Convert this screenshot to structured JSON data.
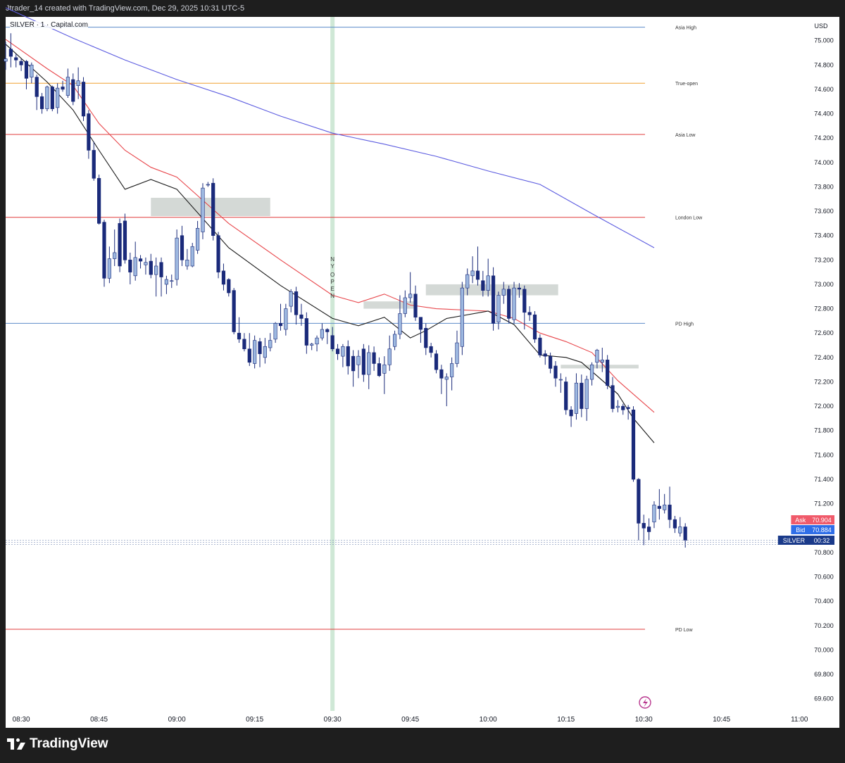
{
  "header": {
    "credit": "Jtrader_14 created with TradingView.com, Dec 29, 2025 10:31 UTC-5"
  },
  "symbol_label": "SILVER · 1 · Capital.com",
  "footer": {
    "brand": "TradingView"
  },
  "colors": {
    "bull": "#9db8e0",
    "bear": "#1a2a7a",
    "ema_fast": "#1b1b1b",
    "ema_mid": "#e8474c",
    "ema_slow": "#5c5ce0",
    "level_blue": "#5b8cc9",
    "level_red": "#e03d3d",
    "level_orange": "#f0a030",
    "zone": "#c5ccc8",
    "session": "#a8d5b4",
    "ask": "#f05a6a",
    "bid": "#2f6ee8",
    "symbol_tag": "#1a3a8a"
  },
  "chart_data": {
    "type": "candlestick",
    "title": "SILVER · 1 · Capital.com",
    "currency": "USD",
    "ylim": [
      69.5,
      75.2
    ],
    "y_ticks": [
      "75.000",
      "74.800",
      "74.600",
      "74.400",
      "74.200",
      "74.000",
      "73.800",
      "73.600",
      "73.400",
      "73.200",
      "73.000",
      "72.800",
      "72.600",
      "72.400",
      "72.200",
      "72.000",
      "71.800",
      "71.600",
      "71.400",
      "71.200",
      "71.000",
      "70.800",
      "70.600",
      "70.400",
      "70.200",
      "70.000",
      "69.800",
      "69.600"
    ],
    "x_ticks": [
      {
        "label": "08:30",
        "minute": 0
      },
      {
        "label": "08:45",
        "minute": 15
      },
      {
        "label": "09:00",
        "minute": 30
      },
      {
        "label": "09:15",
        "minute": 45
      },
      {
        "label": "09:30",
        "minute": 60
      },
      {
        "label": "09:45",
        "minute": 75
      },
      {
        "label": "10:00",
        "minute": 90
      },
      {
        "label": "10:15",
        "minute": 105
      },
      {
        "label": "10:30",
        "minute": 120
      },
      {
        "label": "10:45",
        "minute": 135
      },
      {
        "label": "11:00",
        "minute": 150
      }
    ],
    "xlim_minutes": [
      -3,
      152
    ],
    "levels": [
      {
        "label": "Asia High",
        "price": 75.11,
        "color": "#5b8cc9"
      },
      {
        "label": "True-open",
        "price": 74.65,
        "color": "#f0a030"
      },
      {
        "label": "Asia Low",
        "price": 74.23,
        "color": "#e03d3d"
      },
      {
        "label": "London Low",
        "price": 73.55,
        "color": "#e03d3d"
      },
      {
        "label": "PD High",
        "price": 72.68,
        "color": "#5b8cc9"
      },
      {
        "label": "PD Low",
        "price": 70.17,
        "color": "#e03d3d"
      }
    ],
    "session_marker": {
      "label": "NY OPEN",
      "minute": 60
    },
    "zones": [
      {
        "m0": 25,
        "m1": 48,
        "p0": 73.71,
        "p1": 73.56
      },
      {
        "m0": 66,
        "m1": 76,
        "p0": 72.86,
        "p1": 72.8
      },
      {
        "m0": 78,
        "m1": 103.5,
        "p0": 73.0,
        "p1": 72.91
      },
      {
        "m0": 104,
        "m1": 119,
        "p0": 72.34,
        "p1": 72.31
      }
    ],
    "ema_fast": [
      [
        -3,
        74.97
      ],
      [
        5,
        74.66
      ],
      [
        10,
        74.43
      ],
      [
        15,
        74.1
      ],
      [
        20,
        73.78
      ],
      [
        25,
        73.86
      ],
      [
        30,
        73.78
      ],
      [
        40,
        73.3
      ],
      [
        50,
        72.99
      ],
      [
        60,
        72.72
      ],
      [
        65,
        72.66
      ],
      [
        70,
        72.73
      ],
      [
        75,
        72.56
      ],
      [
        78,
        72.62
      ],
      [
        82,
        72.72
      ],
      [
        90,
        72.78
      ],
      [
        95,
        72.67
      ],
      [
        100,
        72.42
      ],
      [
        105,
        72.4
      ],
      [
        108,
        72.36
      ],
      [
        115,
        72.1
      ],
      [
        118,
        71.9
      ],
      [
        122,
        71.7
      ]
    ],
    "ema_mid": [
      [
        -3,
        75.01
      ],
      [
        5,
        74.77
      ],
      [
        10,
        74.63
      ],
      [
        15,
        74.32
      ],
      [
        20,
        74.1
      ],
      [
        25,
        73.96
      ],
      [
        30,
        73.88
      ],
      [
        40,
        73.5
      ],
      [
        50,
        73.2
      ],
      [
        60,
        72.91
      ],
      [
        65,
        72.85
      ],
      [
        70,
        72.92
      ],
      [
        75,
        72.83
      ],
      [
        80,
        72.8
      ],
      [
        90,
        72.78
      ],
      [
        95,
        72.72
      ],
      [
        100,
        72.6
      ],
      [
        105,
        72.53
      ],
      [
        110,
        72.44
      ],
      [
        115,
        72.21
      ],
      [
        122,
        71.95
      ]
    ],
    "ema_slow": [
      [
        -3,
        75.27
      ],
      [
        10,
        75.02
      ],
      [
        20,
        74.84
      ],
      [
        30,
        74.68
      ],
      [
        40,
        74.54
      ],
      [
        50,
        74.38
      ],
      [
        60,
        74.24
      ],
      [
        70,
        74.15
      ],
      [
        80,
        74.05
      ],
      [
        90,
        73.93
      ],
      [
        100,
        73.82
      ],
      [
        110,
        73.58
      ],
      [
        122,
        73.3
      ]
    ],
    "candles": [
      [
        -3,
        74.83,
        74.85,
        74.99,
        74.76
      ],
      [
        -2,
        74.93,
        74.87,
        75.06,
        74.78
      ],
      [
        -1,
        74.86,
        74.84,
        74.89,
        74.78
      ],
      [
        0,
        74.83,
        74.8,
        74.85,
        74.75
      ],
      [
        1,
        74.83,
        74.69,
        74.84,
        74.6
      ],
      [
        2,
        74.7,
        74.8,
        74.82,
        74.65
      ],
      [
        3,
        74.7,
        74.54,
        74.72,
        74.43
      ],
      [
        4,
        74.54,
        74.44,
        74.57,
        74.4
      ],
      [
        5,
        74.44,
        74.62,
        74.63,
        74.42
      ],
      [
        6,
        74.62,
        74.44,
        74.63,
        74.42
      ],
      [
        7,
        74.45,
        74.61,
        74.65,
        74.4
      ],
      [
        8,
        74.62,
        74.6,
        74.67,
        74.58
      ],
      [
        9,
        74.55,
        74.7,
        74.77,
        74.53
      ],
      [
        10,
        74.68,
        74.5,
        74.73,
        74.47
      ],
      [
        11,
        74.63,
        74.67,
        74.78,
        74.52
      ],
      [
        12,
        74.66,
        74.38,
        74.7,
        74.34
      ],
      [
        13,
        74.4,
        74.1,
        74.43,
        74.03
      ],
      [
        14,
        74.1,
        73.87,
        74.17,
        73.85
      ],
      [
        15,
        73.87,
        73.5,
        73.9,
        73.49
      ],
      [
        16,
        73.51,
        73.05,
        73.53,
        72.98
      ],
      [
        17,
        73.05,
        73.21,
        73.31,
        73.01
      ],
      [
        18,
        73.21,
        73.26,
        73.45,
        73.15
      ],
      [
        19,
        73.5,
        73.15,
        73.54,
        73.1
      ],
      [
        20,
        73.52,
        73.2,
        73.58,
        73.17
      ],
      [
        21,
        73.2,
        73.1,
        73.26,
        73.0
      ],
      [
        22,
        73.07,
        73.22,
        73.35,
        73.03
      ],
      [
        23,
        73.21,
        73.19,
        73.24,
        73.13
      ],
      [
        24,
        73.16,
        73.18,
        73.22,
        73.08
      ],
      [
        25,
        73.19,
        73.08,
        73.25,
        73.05
      ],
      [
        26,
        73.08,
        73.15,
        73.22,
        72.9
      ],
      [
        27,
        73.18,
        73.06,
        73.22,
        72.9
      ],
      [
        28,
        73.0,
        73.04,
        73.07,
        72.92
      ],
      [
        29,
        73.03,
        73.03,
        73.08,
        72.97
      ],
      [
        30,
        73.04,
        73.38,
        73.45,
        72.99
      ],
      [
        31,
        73.4,
        73.2,
        73.48,
        73.15
      ],
      [
        32,
        73.15,
        73.2,
        73.29,
        73.12
      ],
      [
        33,
        73.15,
        73.31,
        73.34,
        73.14
      ],
      [
        34,
        73.28,
        73.46,
        73.52,
        73.25
      ],
      [
        35,
        73.43,
        73.79,
        73.83,
        73.37
      ],
      [
        36,
        73.82,
        73.82,
        73.84,
        73.8
      ],
      [
        37,
        73.83,
        73.4,
        73.87,
        73.36
      ],
      [
        38,
        73.4,
        73.1,
        73.43,
        73.05
      ],
      [
        39,
        73.11,
        73.0,
        73.17,
        72.95
      ],
      [
        40,
        73.04,
        72.93,
        73.05,
        72.9
      ],
      [
        41,
        72.95,
        72.61,
        72.97,
        72.59
      ],
      [
        42,
        72.6,
        72.55,
        72.73,
        72.52
      ],
      [
        43,
        72.55,
        72.47,
        72.6,
        72.45
      ],
      [
        44,
        72.47,
        72.36,
        72.6,
        72.33
      ],
      [
        45,
        72.35,
        72.54,
        72.58,
        72.31
      ],
      [
        46,
        72.53,
        72.43,
        72.56,
        72.32
      ],
      [
        47,
        72.4,
        72.49,
        72.56,
        72.35
      ],
      [
        48,
        72.48,
        72.54,
        72.6,
        72.45
      ],
      [
        49,
        72.55,
        72.68,
        72.69,
        72.52
      ],
      [
        50,
        72.68,
        72.66,
        72.84,
        72.62
      ],
      [
        51,
        72.63,
        72.8,
        72.84,
        72.58
      ],
      [
        52,
        72.82,
        72.94,
        72.96,
        72.77
      ],
      [
        53,
        72.94,
        72.75,
        72.98,
        72.67
      ],
      [
        54,
        72.75,
        72.72,
        72.84,
        72.66
      ],
      [
        55,
        72.72,
        72.5,
        72.77,
        72.43
      ],
      [
        56,
        72.5,
        72.51,
        72.52,
        72.46
      ],
      [
        57,
        72.51,
        72.56,
        72.58,
        72.45
      ],
      [
        58,
        72.56,
        72.63,
        72.68,
        72.54
      ],
      [
        59,
        72.63,
        72.61,
        72.64,
        72.51
      ],
      [
        60,
        72.58,
        72.47,
        72.65,
        72.45
      ],
      [
        61,
        72.47,
        72.43,
        72.51,
        72.38
      ],
      [
        62,
        72.41,
        72.49,
        72.51,
        72.32
      ],
      [
        63,
        72.49,
        72.33,
        72.54,
        72.26
      ],
      [
        64,
        72.41,
        72.29,
        72.46,
        72.16
      ],
      [
        65,
        72.34,
        72.41,
        72.46,
        72.23
      ],
      [
        66,
        72.47,
        72.26,
        72.51,
        72.2
      ],
      [
        67,
        72.26,
        72.44,
        72.5,
        72.14
      ],
      [
        68,
        72.44,
        72.35,
        72.49,
        72.29
      ],
      [
        69,
        72.35,
        72.25,
        72.4,
        72.24
      ],
      [
        70,
        72.27,
        72.34,
        72.41,
        72.1
      ],
      [
        71,
        72.34,
        72.47,
        72.58,
        72.29
      ],
      [
        72,
        72.49,
        72.59,
        72.62,
        72.46
      ],
      [
        73,
        72.59,
        72.76,
        72.91,
        72.55
      ],
      [
        74,
        72.76,
        72.89,
        72.95,
        72.73
      ],
      [
        75,
        72.89,
        72.92,
        73.1,
        72.85
      ],
      [
        76,
        72.92,
        72.73,
        72.99,
        72.7
      ],
      [
        77,
        72.73,
        72.63,
        72.73,
        72.52
      ],
      [
        78,
        72.64,
        72.48,
        72.68,
        72.42
      ],
      [
        79,
        72.49,
        72.44,
        72.52,
        72.4
      ],
      [
        80,
        72.43,
        72.3,
        72.46,
        72.27
      ],
      [
        81,
        72.3,
        72.23,
        72.34,
        72.1
      ],
      [
        82,
        72.22,
        72.24,
        72.27,
        72.0
      ],
      [
        83,
        72.24,
        72.35,
        72.4,
        72.13
      ],
      [
        84,
        72.35,
        72.52,
        72.62,
        72.32
      ],
      [
        85,
        72.49,
        72.97,
        73.02,
        72.42
      ],
      [
        86,
        72.97,
        73.08,
        73.13,
        72.91
      ],
      [
        87,
        73.07,
        73.11,
        73.23,
        73.01
      ],
      [
        88,
        73.11,
        73.04,
        73.31,
        72.99
      ],
      [
        89,
        73.03,
        72.95,
        73.11,
        72.9
      ],
      [
        90,
        72.95,
        73.07,
        73.21,
        72.9
      ],
      [
        91,
        73.07,
        72.68,
        73.14,
        72.62
      ],
      [
        92,
        72.69,
        72.91,
        72.94,
        72.63
      ],
      [
        93,
        72.91,
        72.96,
        73.02,
        72.84
      ],
      [
        94,
        72.96,
        72.72,
        72.99,
        72.68
      ],
      [
        95,
        72.71,
        72.97,
        73.02,
        72.68
      ],
      [
        96,
        72.97,
        72.96,
        73.01,
        72.89
      ],
      [
        97,
        72.96,
        72.77,
        72.99,
        72.63
      ],
      [
        98,
        72.77,
        72.75,
        72.82,
        72.7
      ],
      [
        99,
        72.75,
        72.55,
        72.78,
        72.52
      ],
      [
        100,
        72.56,
        72.42,
        72.59,
        72.4
      ],
      [
        101,
        72.43,
        72.41,
        72.46,
        72.34
      ],
      [
        102,
        72.41,
        72.31,
        72.44,
        72.27
      ],
      [
        103,
        72.33,
        72.23,
        72.37,
        72.16
      ],
      [
        104,
        72.22,
        72.22,
        72.27,
        72.11
      ],
      [
        105,
        72.2,
        71.97,
        72.24,
        71.93
      ],
      [
        106,
        71.97,
        71.92,
        72.0,
        71.83
      ],
      [
        107,
        71.94,
        72.19,
        72.27,
        71.89
      ],
      [
        108,
        72.19,
        71.98,
        72.26,
        71.91
      ],
      [
        109,
        71.98,
        72.22,
        72.25,
        71.88
      ],
      [
        110,
        72.22,
        72.34,
        72.36,
        72.17
      ],
      [
        111,
        72.36,
        72.46,
        72.47,
        72.31
      ],
      [
        112,
        72.36,
        72.38,
        72.48,
        72.28
      ],
      [
        113,
        72.38,
        72.17,
        72.42,
        72.14
      ],
      [
        114,
        72.17,
        71.98,
        72.24,
        71.95
      ],
      [
        115,
        71.99,
        72.0,
        72.05,
        71.95
      ],
      [
        116,
        72.0,
        71.97,
        72.02,
        71.93
      ],
      [
        117,
        71.99,
        71.98,
        72.01,
        71.89
      ],
      [
        118,
        71.97,
        71.4,
        72.0,
        71.38
      ],
      [
        119,
        71.4,
        71.04,
        71.41,
        70.9
      ],
      [
        120,
        71.04,
        71.0,
        71.11,
        70.86
      ],
      [
        121,
        71.01,
        70.97,
        71.08,
        70.9
      ],
      [
        122,
        71.05,
        71.19,
        71.22,
        71.0
      ],
      [
        123,
        71.18,
        71.16,
        71.32,
        71.07
      ],
      [
        124,
        71.15,
        71.19,
        71.28,
        71.12
      ],
      [
        125,
        71.19,
        71.07,
        71.34,
        71.0
      ],
      [
        126,
        71.07,
        71.0,
        71.1,
        70.96
      ],
      [
        127,
        70.96,
        71.01,
        71.09,
        70.93
      ],
      [
        128,
        71.01,
        70.9,
        71.04,
        70.84
      ]
    ],
    "price_labels": [
      {
        "tag": "Ask",
        "value": "70.904"
      },
      {
        "tag": "Bid",
        "value": "70.884"
      },
      {
        "tag": "SILVER",
        "value": "00:32"
      }
    ]
  }
}
